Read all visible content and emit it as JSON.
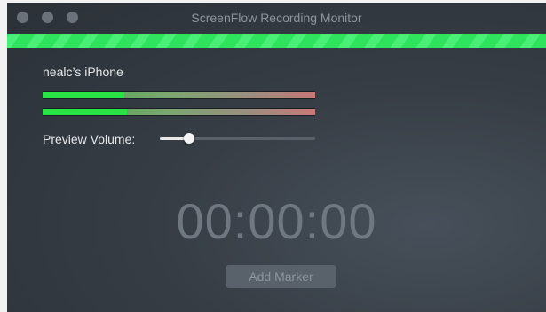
{
  "window": {
    "title": "ScreenFlow Recording Monitor",
    "controls": [
      "close-button",
      "minimize-button",
      "zoom-button"
    ]
  },
  "status": {
    "recording_bar_color": "#2fe35f"
  },
  "device": {
    "name": "nealc’s iPhone"
  },
  "meters": {
    "left_level": 0.3,
    "right_level": 0.31
  },
  "preview_volume": {
    "label": "Preview Volume:",
    "level": 0.19
  },
  "timer": {
    "value": "00:00:00"
  },
  "actions": {
    "add_marker_label": "Add Marker"
  }
}
